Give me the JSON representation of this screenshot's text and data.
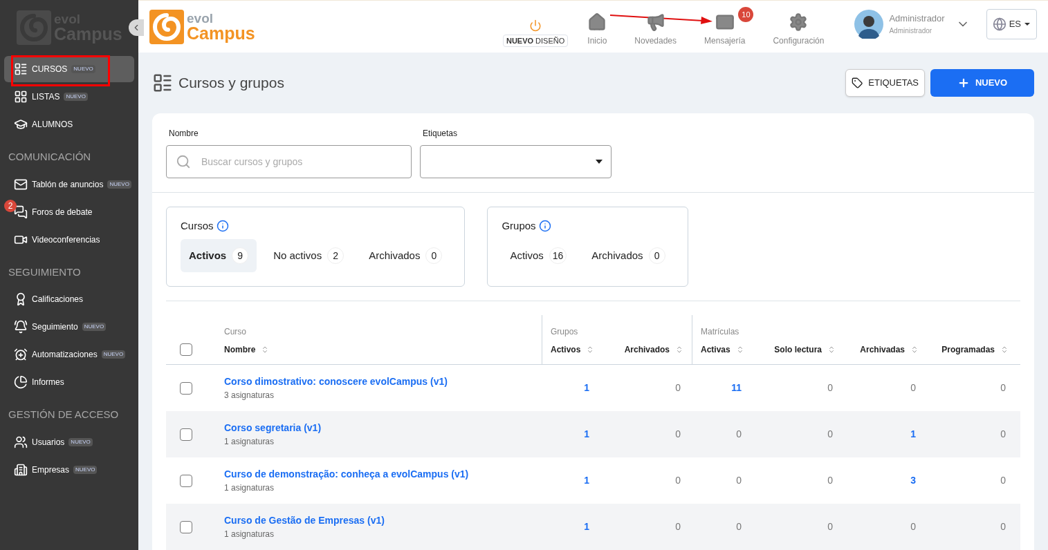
{
  "sidebar": {
    "logo": {
      "top": "evol",
      "bottom": "Campus"
    },
    "sections": [
      {
        "items": [
          {
            "label": "CURSOS",
            "badge": "NUEVO",
            "selected": true
          },
          {
            "label": "LISTAS",
            "badge": "NUEVO",
            "selected": false
          },
          {
            "label": "ALUMNOS",
            "selected": false
          }
        ]
      },
      {
        "heading": "COMUNICACIÓN",
        "items": [
          {
            "label": "Tablón de anuncios",
            "badge": "NUEVO",
            "selected": false
          },
          {
            "label": "Foros de debate",
            "count": "2",
            "selected": false
          },
          {
            "label": "Videoconferencias",
            "selected": false
          }
        ]
      },
      {
        "heading": "SEGUIMIENTO",
        "items": [
          {
            "label": "Calificaciones",
            "selected": false
          },
          {
            "label": "Seguimiento",
            "badge": "NUEVO",
            "selected": false
          },
          {
            "label": "Automatizaciones",
            "badge": "NUEVO",
            "selected": false
          },
          {
            "label": "Informes",
            "selected": false
          }
        ]
      },
      {
        "heading": "GESTIÓN DE ACCESO",
        "items": [
          {
            "label": "Usuarios",
            "badge": "NUEVO",
            "selected": false
          },
          {
            "label": "Empresas",
            "badge": "NUEVO",
            "selected": false
          }
        ]
      }
    ]
  },
  "header": {
    "logo": {
      "top": "evol",
      "bottom": "Campus"
    },
    "new_design": "**NUEVO** DISEÑO",
    "nav": [
      {
        "label": "Inicio"
      },
      {
        "label": "Novedades"
      },
      {
        "label": "Mensajería",
        "count": "10"
      },
      {
        "label": "Configuración"
      }
    ],
    "user": {
      "name": "Administrador",
      "role": "Administrador"
    },
    "language": "ES"
  },
  "page": {
    "title": "Cursos y grupos",
    "buttons": [
      {
        "label": "ETIQUETAS",
        "kind": "tags"
      },
      {
        "label": "NUEVO",
        "kind": "primary"
      }
    ],
    "filters": {
      "name": {
        "label": "Nombre",
        "placeholder": "Buscar cursos y grupos"
      },
      "tags": {
        "label": "Etiquetas"
      }
    },
    "stats": [
      {
        "title": "Cursos",
        "tabs": [
          {
            "label": "Activos",
            "count": "9",
            "selected": true
          },
          {
            "label": "No activos",
            "count": "2",
            "selected": false
          },
          {
            "label": "Archivados",
            "count": "0",
            "selected": false
          }
        ]
      },
      {
        "title": "Grupos",
        "tabs": [
          {
            "label": "Activos",
            "count": "16",
            "selected": false
          },
          {
            "label": "Archivados",
            "count": "0",
            "selected": false
          }
        ]
      }
    ]
  },
  "table": {
    "select_all_checked": false,
    "groups": [
      "Curso",
      "Grupos",
      "Matrículas"
    ],
    "columns": [
      "Nombre",
      "Activos",
      "Archivados",
      "Activas",
      "Solo lectura",
      "Archivadas",
      "Programadas"
    ],
    "rows": [
      {
        "checked": false,
        "name": "Corso dimostrativo: conoscere evolCampus (v1)",
        "subtitle": "3 asignaturas",
        "cells": [
          {
            "value": "1",
            "linked": true
          },
          {
            "value": "0",
            "linked": false
          },
          {
            "value": "11",
            "linked": true
          },
          {
            "value": "0",
            "linked": false
          },
          {
            "value": "0",
            "linked": false
          },
          {
            "value": "0",
            "linked": false
          }
        ]
      },
      {
        "checked": false,
        "name": "Corso segretaria (v1)",
        "subtitle": "1 asignaturas",
        "cells": [
          {
            "value": "1",
            "linked": true
          },
          {
            "value": "0",
            "linked": false
          },
          {
            "value": "0",
            "linked": false
          },
          {
            "value": "0",
            "linked": false
          },
          {
            "value": "1",
            "linked": true
          },
          {
            "value": "0",
            "linked": false
          }
        ]
      },
      {
        "checked": false,
        "name": "Curso de demonstração: conheça a evolCampus (v1)",
        "subtitle": "1 asignaturas",
        "cells": [
          {
            "value": "1",
            "linked": true
          },
          {
            "value": "0",
            "linked": false
          },
          {
            "value": "0",
            "linked": false
          },
          {
            "value": "0",
            "linked": false
          },
          {
            "value": "3",
            "linked": true
          },
          {
            "value": "0",
            "linked": false
          }
        ]
      },
      {
        "checked": false,
        "name": "Curso de Gestão de Empresas (v1)",
        "subtitle": "1 asignaturas",
        "cells": [
          {
            "value": "1",
            "linked": true
          },
          {
            "value": "0",
            "linked": false
          },
          {
            "value": "0",
            "linked": false
          },
          {
            "value": "0",
            "linked": false
          },
          {
            "value": "0",
            "linked": false
          },
          {
            "value": "0",
            "linked": false
          }
        ]
      }
    ]
  }
}
